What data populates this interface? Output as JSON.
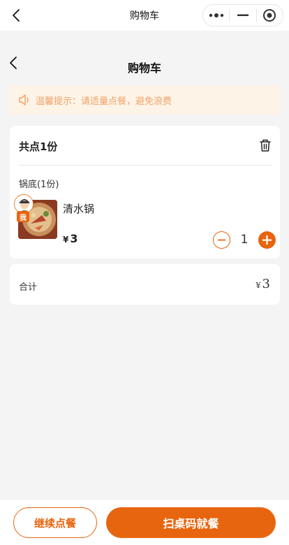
{
  "topbar": {
    "title": "购物车"
  },
  "page": {
    "title": "购物车"
  },
  "notice": {
    "text": "温馨提示：请适量点餐，避免浪费"
  },
  "cart": {
    "count_label": "共点1份",
    "group_label": "锅底(1份)",
    "item": {
      "name": "清水锅",
      "currency": "¥",
      "price": "3",
      "quantity": "1",
      "owner_badge": "我"
    }
  },
  "total": {
    "label": "合计",
    "currency": "¥",
    "value": "3"
  },
  "actions": {
    "continue_label": "继续点餐",
    "scan_label": "扫桌码就餐"
  },
  "colors": {
    "accent": "#e8650f",
    "notice_bg": "#fdf3e6",
    "notice_text": "#f0a36a",
    "page_bg": "#f4f4f4"
  }
}
